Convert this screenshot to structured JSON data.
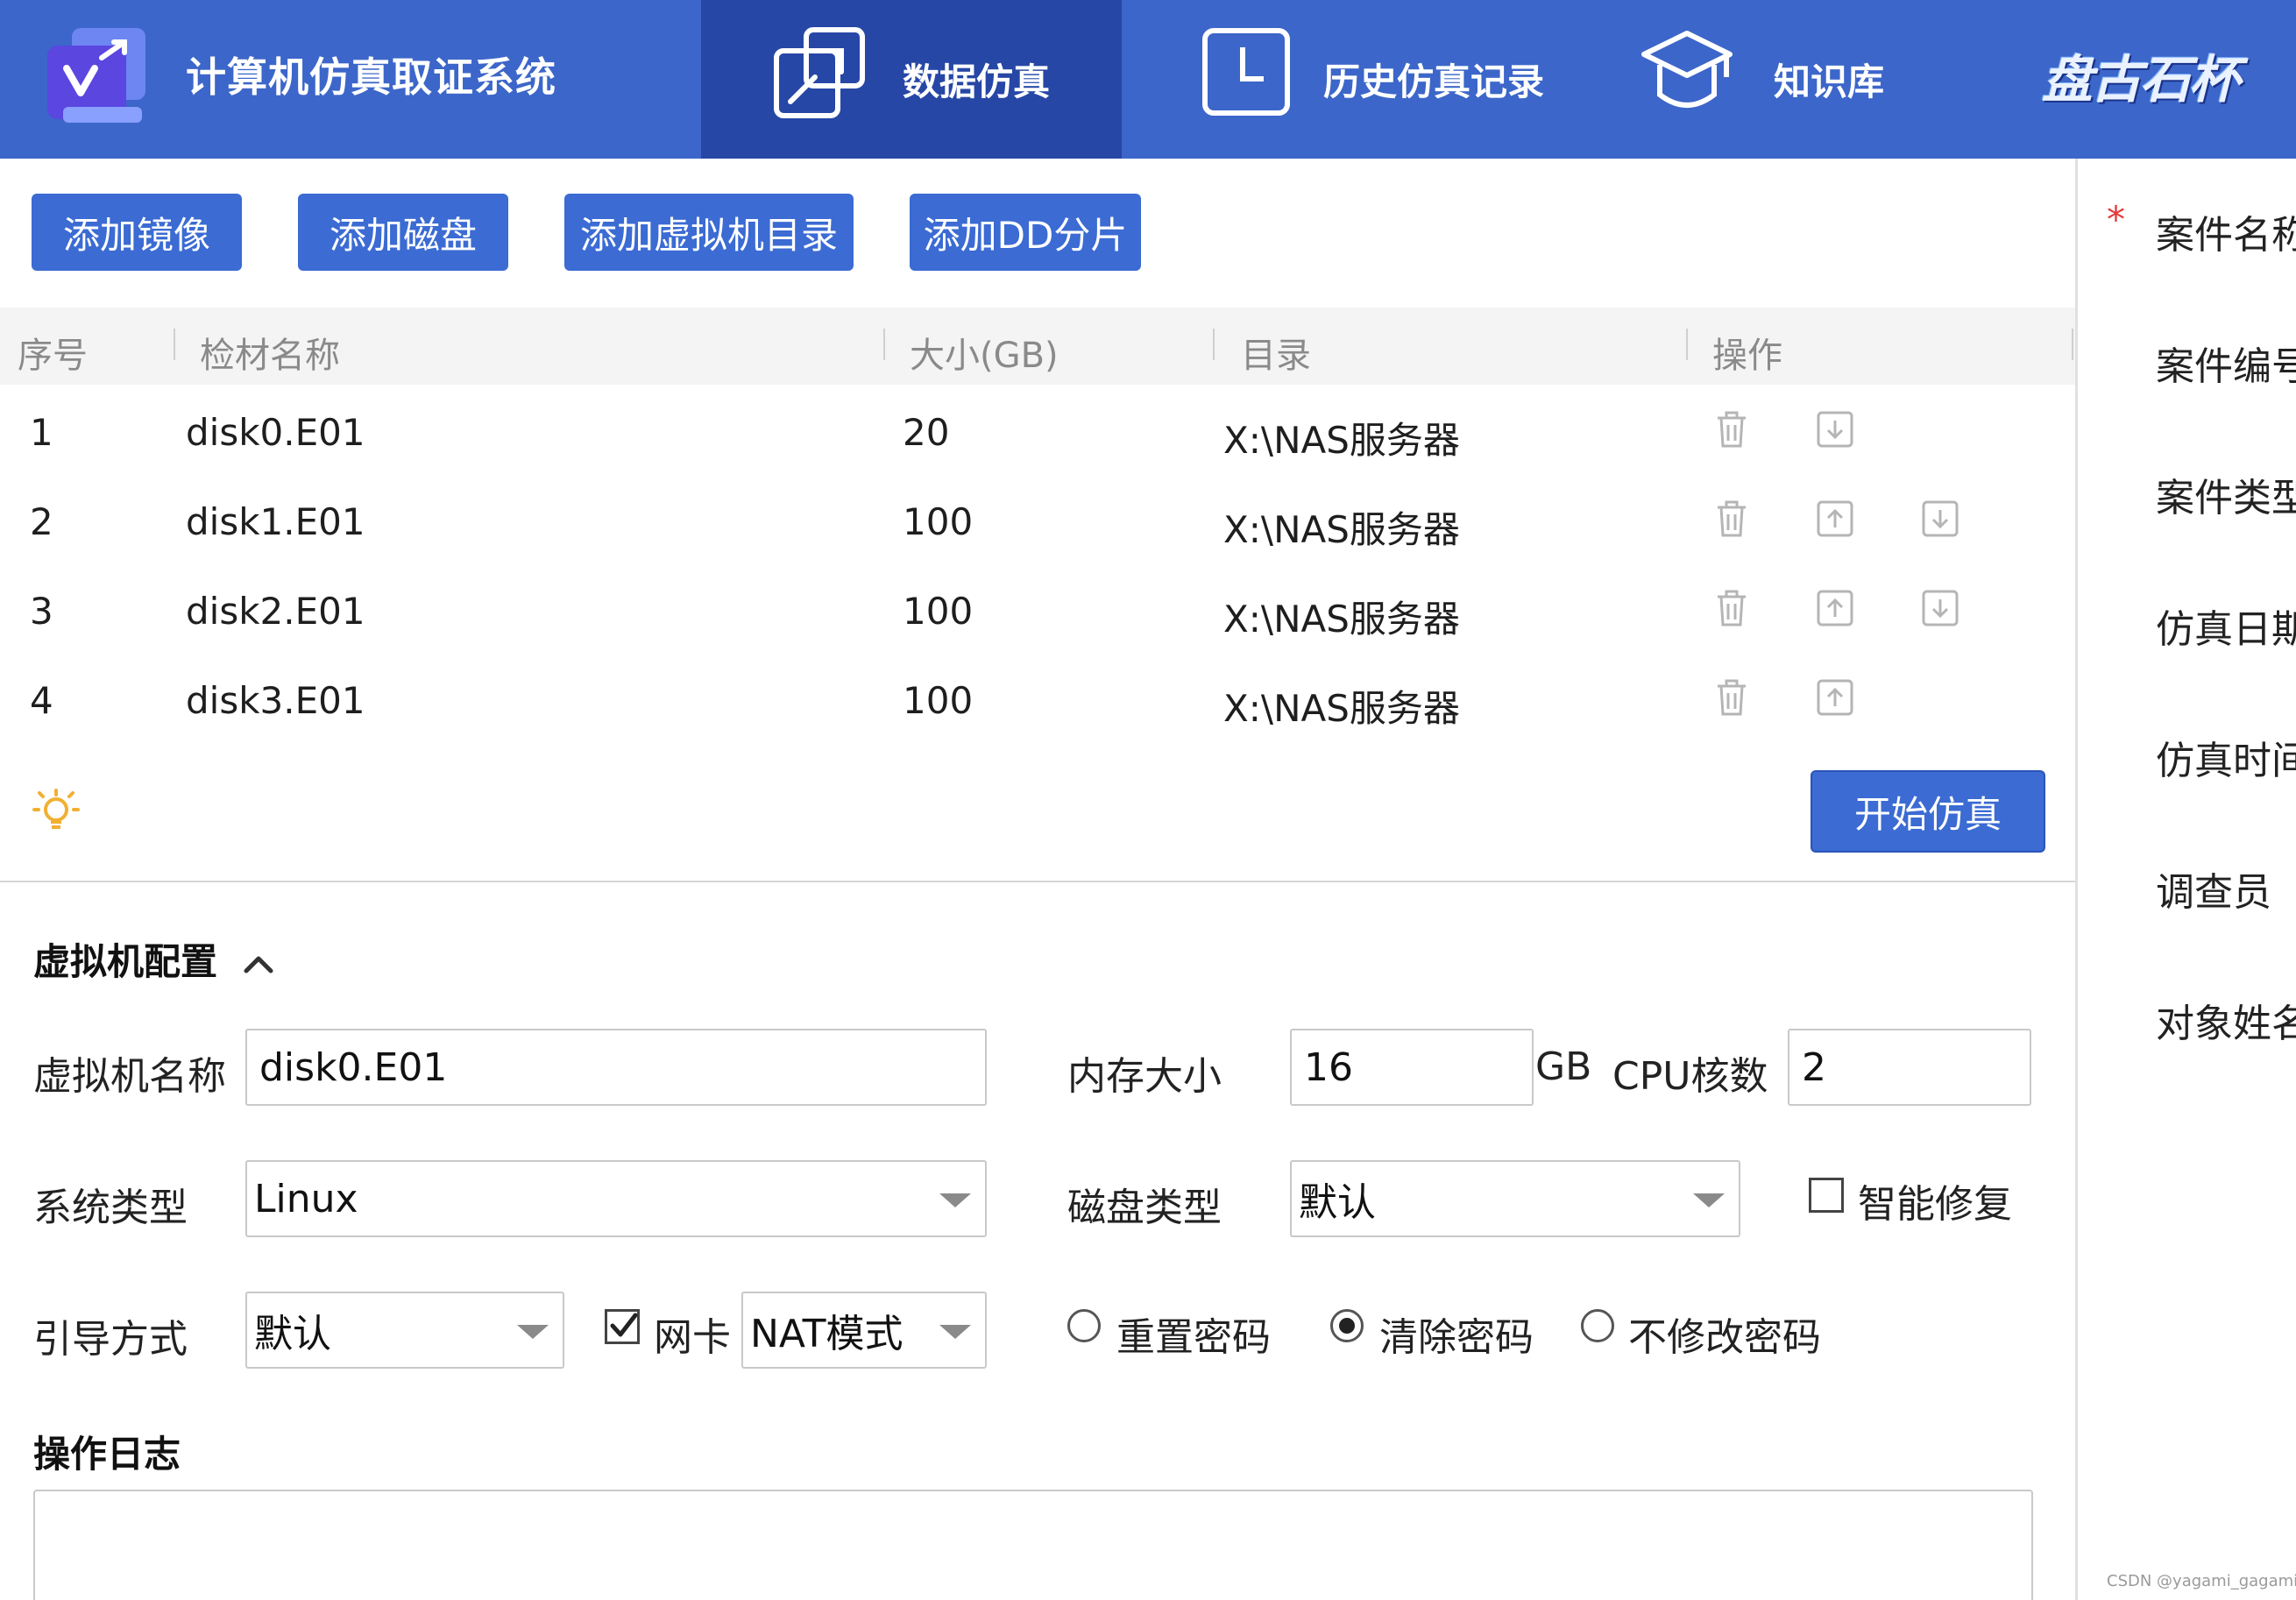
{
  "header": {
    "app_title": "计算机仿真取证系统",
    "tabs": [
      {
        "label": "数据仿真",
        "icon": "external-link-icon",
        "active": true
      },
      {
        "label": "历史仿真记录",
        "icon": "clock-icon",
        "active": false
      },
      {
        "label": "知识库",
        "icon": "graduation-cap-icon",
        "active": false
      }
    ],
    "brand_logo_text": "盘古石杯"
  },
  "toolbar": {
    "add_image": "添加镜像",
    "add_disk": "添加磁盘",
    "add_vm_dir": "添加虚拟机目录",
    "add_dd_split": "添加DD分片"
  },
  "table": {
    "columns": [
      "序号",
      "检材名称",
      "大小(GB)",
      "目录",
      "操作"
    ],
    "rows": [
      {
        "index": "1",
        "name": "disk0.E01",
        "size": "20",
        "dir": "X:\\NAS服务器",
        "actions": [
          "delete",
          "move-down"
        ]
      },
      {
        "index": "2",
        "name": "disk1.E01",
        "size": "100",
        "dir": "X:\\NAS服务器",
        "actions": [
          "delete",
          "move-up",
          "move-down"
        ]
      },
      {
        "index": "3",
        "name": "disk2.E01",
        "size": "100",
        "dir": "X:\\NAS服务器",
        "actions": [
          "delete",
          "move-up",
          "move-down"
        ]
      },
      {
        "index": "4",
        "name": "disk3.E01",
        "size": "100",
        "dir": "X:\\NAS服务器",
        "actions": [
          "delete",
          "move-up"
        ]
      }
    ]
  },
  "start_button": "开始仿真",
  "vm_config": {
    "title": "虚拟机配置",
    "vm_name_label": "虚拟机名称",
    "vm_name_value": "disk0.E01",
    "memory_label": "内存大小",
    "memory_value": "16",
    "memory_unit": "GB",
    "cpu_label": "CPU核数",
    "cpu_value": "2",
    "os_type_label": "系统类型",
    "os_type_value": "Linux",
    "disk_type_label": "磁盘类型",
    "disk_type_value": "默认",
    "smart_repair_label": "智能修复",
    "smart_repair_checked": false,
    "boot_label": "引导方式",
    "boot_value": "默认",
    "nic_label": "网卡",
    "nic_checked": true,
    "nic_mode_value": "NAT模式",
    "password_options": [
      {
        "label": "重置密码",
        "selected": false
      },
      {
        "label": "清除密码",
        "selected": true
      },
      {
        "label": "不修改密码",
        "selected": false
      }
    ]
  },
  "log": {
    "title": "操作日志",
    "content": ""
  },
  "right_panel": {
    "required_mark": "*",
    "labels": [
      "案件名称",
      "案件编号",
      "案件类型",
      "仿真日期",
      "仿真时间",
      "调查员",
      "对象姓名"
    ]
  },
  "watermark": "CSDN @yagami_gagami"
}
